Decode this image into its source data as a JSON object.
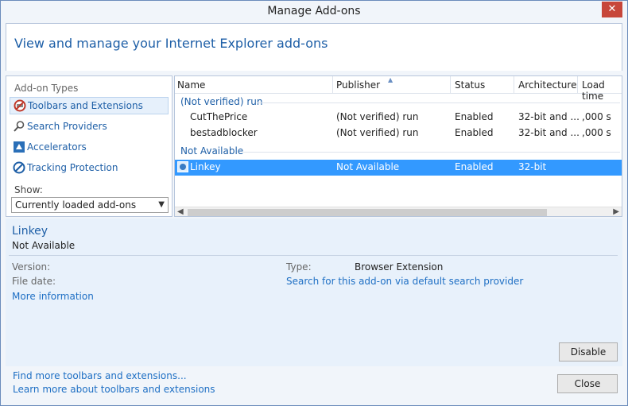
{
  "window": {
    "title": "Manage Add-ons",
    "close_glyph": "✕"
  },
  "header": {
    "text": "View and manage your Internet Explorer add-ons"
  },
  "left_panel": {
    "types_label": "Add-on Types",
    "types": [
      {
        "label": "Toolbars and Extensions",
        "icon": "toolbars-extensions-icon"
      },
      {
        "label": "Search Providers",
        "icon": "search-icon"
      },
      {
        "label": "Accelerators",
        "icon": "accelerators-icon"
      },
      {
        "label": "Tracking Protection",
        "icon": "tracking-protection-icon"
      }
    ],
    "show_label": "Show:",
    "show_value": "Currently loaded add-ons"
  },
  "grid": {
    "columns": [
      "Name",
      "Publisher",
      "Status",
      "Architecture",
      "Load time"
    ],
    "groups": [
      {
        "label": "(Not verified) run",
        "rows": [
          {
            "name": "CutThePrice",
            "publisher": "(Not verified) run",
            "status": "Enabled",
            "architecture": "32-bit and ...",
            "load_time": ",000 s"
          },
          {
            "name": "bestadblocker",
            "publisher": "(Not verified) run",
            "status": "Enabled",
            "architecture": "32-bit and ...",
            "load_time": ",000 s"
          }
        ]
      },
      {
        "label": "Not Available",
        "rows": [
          {
            "name": "Linkey",
            "publisher": "Not Available",
            "status": "Enabled",
            "architecture": "32-bit",
            "load_time": ""
          }
        ]
      }
    ]
  },
  "details": {
    "name": "Linkey",
    "publisher": "Not Available",
    "version_label": "Version:",
    "file_date_label": "File date:",
    "more_info_link": "More information",
    "type_label": "Type:",
    "type_value": "Browser Extension",
    "search_link": "Search for this add-on via default search provider",
    "disable_button": "Disable"
  },
  "footer": {
    "find_more_link": "Find more toolbars and extensions...",
    "learn_more_link": "Learn more about toolbars and extensions",
    "close_button": "Close"
  },
  "colors": {
    "accent": "#1e5fa7",
    "selection": "#3399ff",
    "link": "#1e6fc4"
  }
}
